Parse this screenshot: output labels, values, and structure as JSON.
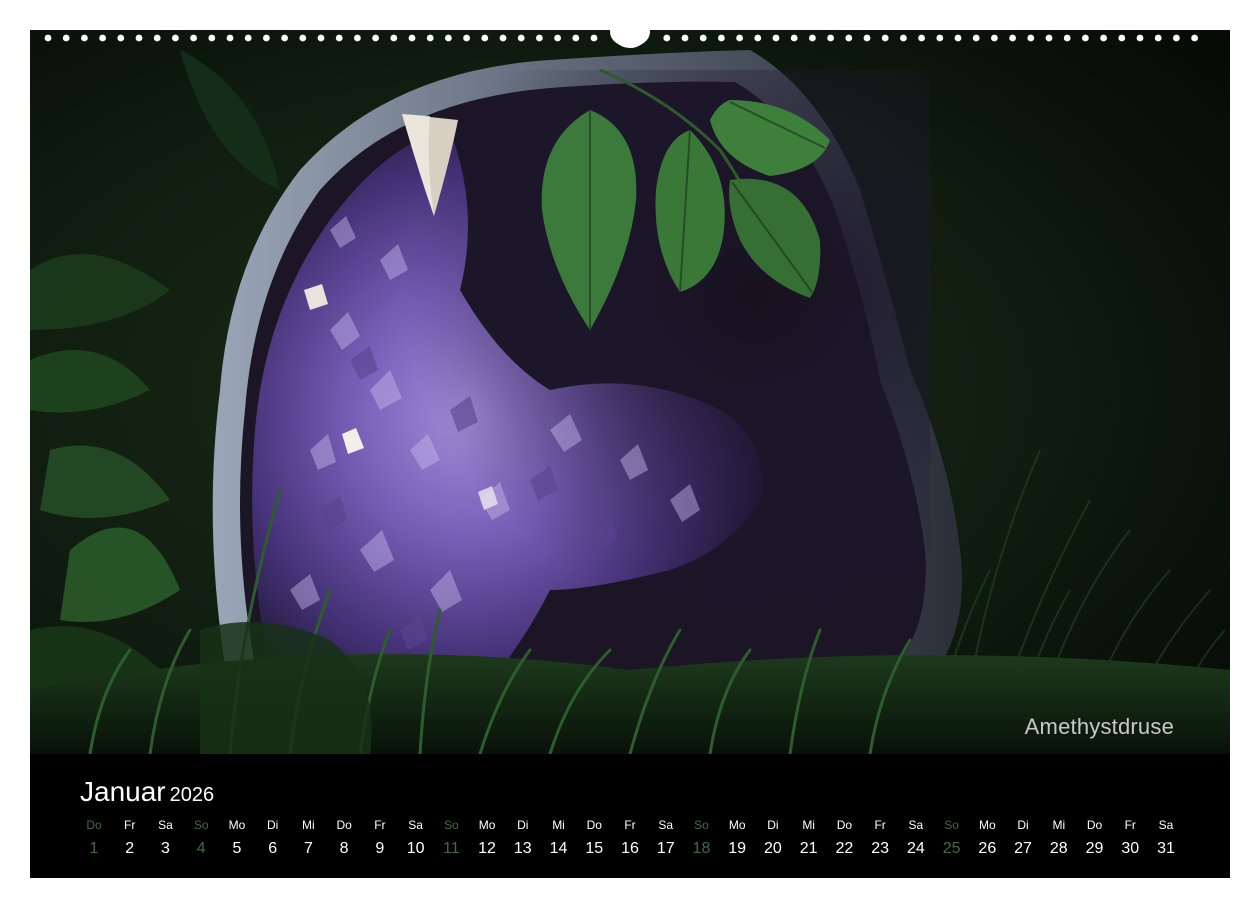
{
  "photo": {
    "caption": "Amethystdruse"
  },
  "calendar": {
    "month": "Januar",
    "year": "2026",
    "weekend_color": "#3f6b45",
    "days": [
      {
        "wd": "Do",
        "d": "1"
      },
      {
        "wd": "Fr",
        "d": "2"
      },
      {
        "wd": "Sa",
        "d": "3"
      },
      {
        "wd": "So",
        "d": "4"
      },
      {
        "wd": "Mo",
        "d": "5"
      },
      {
        "wd": "Di",
        "d": "6"
      },
      {
        "wd": "Mi",
        "d": "7"
      },
      {
        "wd": "Do",
        "d": "8"
      },
      {
        "wd": "Fr",
        "d": "9"
      },
      {
        "wd": "Sa",
        "d": "10"
      },
      {
        "wd": "So",
        "d": "11"
      },
      {
        "wd": "Mo",
        "d": "12"
      },
      {
        "wd": "Di",
        "d": "13"
      },
      {
        "wd": "Mi",
        "d": "14"
      },
      {
        "wd": "Do",
        "d": "15"
      },
      {
        "wd": "Fr",
        "d": "16"
      },
      {
        "wd": "Sa",
        "d": "17"
      },
      {
        "wd": "So",
        "d": "18"
      },
      {
        "wd": "Mo",
        "d": "19"
      },
      {
        "wd": "Di",
        "d": "20"
      },
      {
        "wd": "Mi",
        "d": "21"
      },
      {
        "wd": "Do",
        "d": "22"
      },
      {
        "wd": "Fr",
        "d": "23"
      },
      {
        "wd": "Sa",
        "d": "24"
      },
      {
        "wd": "So",
        "d": "25"
      },
      {
        "wd": "Mo",
        "d": "26"
      },
      {
        "wd": "Di",
        "d": "27"
      },
      {
        "wd": "Mi",
        "d": "28"
      },
      {
        "wd": "Do",
        "d": "29"
      },
      {
        "wd": "Fr",
        "d": "30"
      },
      {
        "wd": "Sa",
        "d": "31"
      }
    ]
  }
}
